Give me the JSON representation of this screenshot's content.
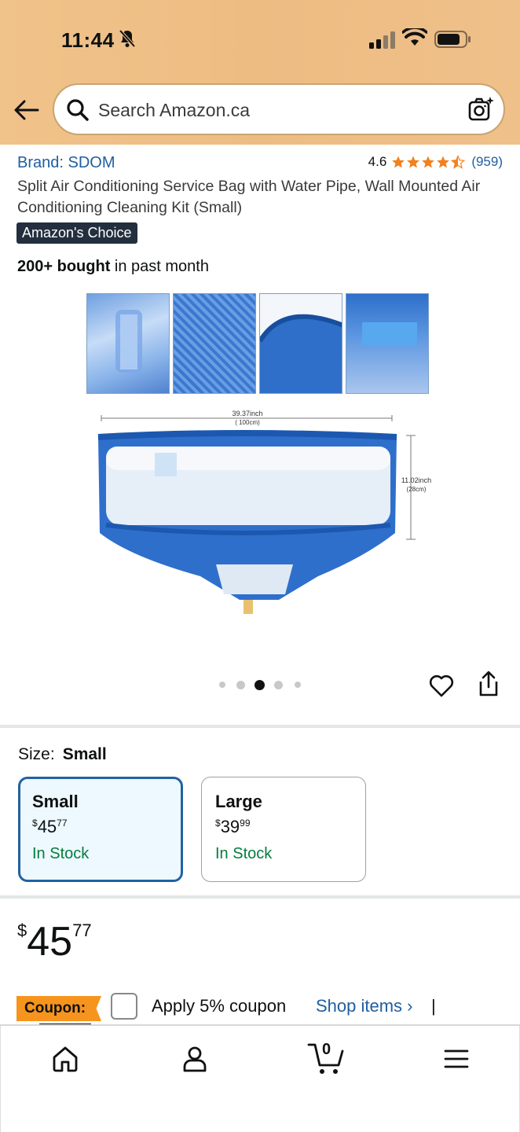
{
  "status": {
    "time": "11:44"
  },
  "search": {
    "placeholder": "Search Amazon.ca"
  },
  "product": {
    "brand": "Brand: SDOM",
    "rating_value": "4.6",
    "rating_count": "(959)",
    "rating_stars": 4.5,
    "title": "Split Air Conditioning Service Bag with Water Pipe, Wall Mounted Air Conditioning Cleaning Kit (Small)",
    "badge": "Amazon's Choice",
    "bought_bold": "200+ bought",
    "bought_rest": " in past month"
  },
  "image": {
    "width_label": "39.37inch",
    "width_label_2": "( 100cm)",
    "height_label": "11.02inch",
    "height_label_2": "(28cm)",
    "carousel_total": 5,
    "carousel_active": 3
  },
  "size": {
    "label": "Size:",
    "selected": "Small",
    "options": [
      {
        "name": "Small",
        "currency": "$",
        "whole": "45",
        "cents": "77",
        "stock": "In Stock"
      },
      {
        "name": "Large",
        "currency": "$",
        "whole": "39",
        "cents": "99",
        "stock": "In Stock"
      }
    ]
  },
  "price": {
    "currency": "$",
    "whole": "45",
    "cents": "77"
  },
  "coupon": {
    "badge": "Coupon:",
    "text": "Apply 5% coupon",
    "link": "Shop items ›",
    "separator": "|"
  },
  "colors": {
    "header": "#efc089",
    "link": "#1f5fa0",
    "stock": "#067d3d",
    "coupon": "#f7941d",
    "star": "#f3811b"
  },
  "nav": {
    "cart_count": "0"
  }
}
